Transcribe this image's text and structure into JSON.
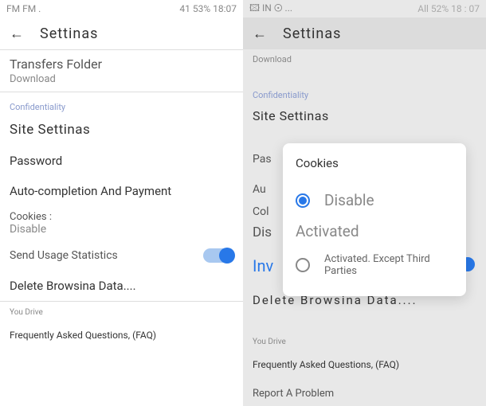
{
  "left": {
    "status": {
      "left": "FM FM .",
      "right": "41 53% 18:07"
    },
    "appbar": {
      "title": "Settinas"
    },
    "transfers": {
      "title": "Transfers Folder",
      "sub": "Download"
    },
    "confidentiality_label": "Confidentiality",
    "site_settings": "Site Settinas",
    "password": "Password",
    "auto_completion": "Auto-completion And Payment",
    "cookies": {
      "label": "Cookies :",
      "value": "Disable"
    },
    "send_stats": "Send Usage Statistics",
    "delete_browsing": "Delete Browsina Data....",
    "you_drive": "You Drive",
    "faq": "Frequently Asked Questions, (FAQ)"
  },
  "right": {
    "status": {
      "left": "🖾 IN ⊙ ...",
      "right": "All 52% 18 : 07"
    },
    "appbar": {
      "title": "Settinas"
    },
    "download": "Download",
    "confidentiality_label": "Confidentiality",
    "site_settings": "Site Settinas",
    "behind": {
      "pas": "Pas",
      "au": "Au",
      "col": "Col",
      "dis": "Dis",
      "inv": "Inv"
    },
    "delete_browsing": "Delete Browsina Data....",
    "you_drive": "You Drive",
    "faq": "Frequently Asked Questions, (FAQ)",
    "report": "Report A Problem",
    "dialog": {
      "title": "Cookies",
      "opt1": "Disable",
      "opt2": "Activated",
      "opt3": "Activated. Except Third Parties"
    }
  }
}
